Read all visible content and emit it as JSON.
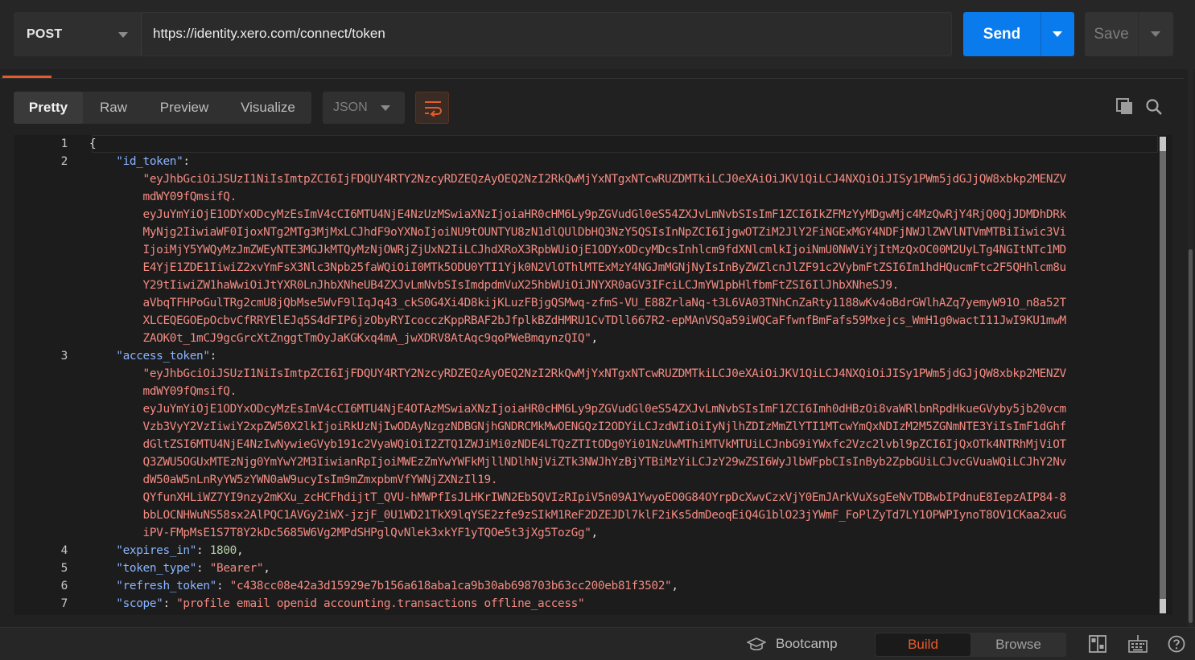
{
  "request": {
    "method": "POST",
    "url": "https://identity.xero.com/connect/token",
    "send_label": "Send",
    "save_label": "Save"
  },
  "response": {
    "view_modes": [
      "Pretty",
      "Raw",
      "Preview",
      "Visualize"
    ],
    "active_view": "Pretty",
    "format": "JSON",
    "lines": [
      {
        "n": "1",
        "parts": [
          {
            "t": "{",
            "c": "punc"
          }
        ]
      },
      {
        "n": "2",
        "parts": [
          {
            "t": "    ",
            "c": "punc"
          },
          {
            "t": "\"id_token\"",
            "c": "key"
          },
          {
            "t": ":",
            "c": "punc"
          }
        ]
      },
      {
        "n": "",
        "parts": [
          {
            "t": "        \"eyJhbGciOiJSUzI1NiIsImtpZCI6IjFDQUY4RTY2NzcyRDZEQzAyOEQ2NzI2RkQwMjYxNTgxNTcwRUZDMTkiLCJ0eXAiOiJKV1QiLCJ4NXQiOiJISy1PWm5jdGJjQW8xbkp2MENZV",
            "c": "str"
          }
        ]
      },
      {
        "n": "",
        "parts": [
          {
            "t": "        mdWY09fQmsifQ.",
            "c": "str"
          }
        ]
      },
      {
        "n": "",
        "parts": [
          {
            "t": "        eyJuYmYiOjE1ODYxODcyMzEsImV4cCI6MTU4NjE4NzUzMSwiaXNzIjoiaHR0cHM6Ly9pZGVudGl0eS54ZXJvLmNvbSIsImF1ZCI6IkZFMzYyMDgwMjc4MzQwRjY4RjQ0QjJDMDhDRk",
            "c": "str"
          }
        ]
      },
      {
        "n": "",
        "parts": [
          {
            "t": "        MyNjg2IiwiaWF0IjoxNTg2MTg3MjMxLCJhdF9oYXNoIjoiNU9tOUNTYU8zN1dlQUlDbHQ3NzY5QSIsInNpZCI6IjgwOTZiM2JlY2FiNGExMGY4NDFjNWJlZWVlNTVmMTBiIiwic3Vi",
            "c": "str"
          }
        ]
      },
      {
        "n": "",
        "parts": [
          {
            "t": "        IjoiMjY5YWQyMzJmZWEyNTE3MGJkMTQyMzNjOWRjZjUxN2IiLCJhdXRoX3RpbWUiOjE1ODYxODcyMDcsInhlcm9fdXNlcmlkIjoiNmU0NWViYjItMzQxOC00M2UyLTg4NGItNTc1MD",
            "c": "str"
          }
        ]
      },
      {
        "n": "",
        "parts": [
          {
            "t": "        E4YjE1ZDE1IiwiZ2xvYmFsX3Nlc3Npb25faWQiOiI0MTk5ODU0YTI1Yjk0N2VlOThlMTExMzY4NGJmMGNjNyIsInByZWZlcnJlZF91c2VybmFtZSI6Im1hdHQucmFtc2F5QHhlcm8u",
            "c": "str"
          }
        ]
      },
      {
        "n": "",
        "parts": [
          {
            "t": "        Y29tIiwiZW1haWwiOiJtYXR0LnJhbXNheUB4ZXJvLmNvbSIsImdpdmVuX25hbWUiOiJNYXR0aGV3IFciLCJmYW1pbHlfbmFtZSI6IlJhbXNheSJ9.",
            "c": "str"
          }
        ]
      },
      {
        "n": "",
        "parts": [
          {
            "t": "        aVbqTFHPoGulTRg2cmU8jQbMse5WvF9lIqJq43_ckS0G4Xi4D8kijKLuzFBjgQSMwq-zfmS-VU_E88ZrlaNq-t3L6VA03TNhCnZaRty1188wKv4oBdrGWlhAZq7yemyW91O_n8a52T",
            "c": "str"
          }
        ]
      },
      {
        "n": "",
        "parts": [
          {
            "t": "        XLCEQEGOEpOcbvCfRRYElEJq5S4dFIP6jzObyRYIcocczKppRBAF2bJfplkBZdHMRU1CvTDll667R2-epMAnVSQa59iWQCaFfwnfBmFafs59Mxejcs_WmH1g0wactI11JwI9KU1mwM",
            "c": "str"
          }
        ]
      },
      {
        "n": "",
        "parts": [
          {
            "t": "        ZAOK0t_1mCJ9gcGrcXtZnggtTmOyJaKGKxq4mA_jwXDRV8AtAqc9qoPWeBmqynzQIQ\"",
            "c": "str"
          },
          {
            "t": ",",
            "c": "punc"
          }
        ]
      },
      {
        "n": "3",
        "parts": [
          {
            "t": "    ",
            "c": "punc"
          },
          {
            "t": "\"access_token\"",
            "c": "key"
          },
          {
            "t": ":",
            "c": "punc"
          }
        ]
      },
      {
        "n": "",
        "parts": [
          {
            "t": "        \"eyJhbGciOiJSUzI1NiIsImtpZCI6IjFDQUY4RTY2NzcyRDZEQzAyOEQ2NzI2RkQwMjYxNTgxNTcwRUZDMTkiLCJ0eXAiOiJKV1QiLCJ4NXQiOiJISy1PWm5jdGJjQW8xbkp2MENZV",
            "c": "str"
          }
        ]
      },
      {
        "n": "",
        "parts": [
          {
            "t": "        mdWY09fQmsifQ.",
            "c": "str"
          }
        ]
      },
      {
        "n": "",
        "parts": [
          {
            "t": "        eyJuYmYiOjE1ODYxODcyMzEsImV4cCI6MTU4NjE4OTAzMSwiaXNzIjoiaHR0cHM6Ly9pZGVudGl0eS54ZXJvLmNvbSIsImF1ZCI6Imh0dHBzOi8vaWRlbnRpdHkueGVyby5jb20vcm",
            "c": "str"
          }
        ]
      },
      {
        "n": "",
        "parts": [
          {
            "t": "        Vzb3VyY2VzIiwiY2xpZW50X2lkIjoiRkUzNjIwODAyNzgzNDBGNjhGNDRCMkMwOENGQzI2ODYiLCJzdWIiOiIyNjlhZDIzMmZlYTI1MTcwYmQxNDIzM2M5ZGNmNTE3YiIsImF1dGhf",
            "c": "str"
          }
        ]
      },
      {
        "n": "",
        "parts": [
          {
            "t": "        dGltZSI6MTU4NjE4NzIwNywieGVyb191c2VyaWQiOiI2ZTQ1ZWJiMi0zNDE4LTQzZTItODg0Yi01NzUwMThiMTVkMTUiLCJnbG9iYWxfc2Vzc2lvbl9pZCI6IjQxOTk4NTRhMjViOT",
            "c": "str"
          }
        ]
      },
      {
        "n": "",
        "parts": [
          {
            "t": "        Q3ZWU5OGUxMTEzNjg0YmYwY2M3IiwianRpIjoiMWEzZmYwYWFkMjllNDlhNjViZTk3NWJhYzBjYTBiMzYiLCJzY29wZSI6WyJlbWFpbCIsInByb2ZpbGUiLCJvcGVuaWQiLCJhY2Nv",
            "c": "str"
          }
        ]
      },
      {
        "n": "",
        "parts": [
          {
            "t": "        dW50aW5nLnRyYW5zYWN0aW9ucyIsIm9mZmxpbmVfYWNjZXNzIl19.",
            "c": "str"
          }
        ]
      },
      {
        "n": "",
        "parts": [
          {
            "t": "        QYfunXHLiWZ7YI9nzy2mKXu_zcHCFhdijtT_QVU-hMWPfIsJLHKrIWN2Eb5QVIzRIpiV5n09A1YwyoEO0G84OYrpDcXwvCzxVjY0EmJArkVuXsgEeNvTDBwbIPdnuE8IepzAIP84-8",
            "c": "str"
          }
        ]
      },
      {
        "n": "",
        "parts": [
          {
            "t": "        bbLOCNHWuNS58sx2AlPQC1AVGy2iWX-jzjF_0U1WD21TkX9lqYSE2zfe9zSIkM1ReF2DZEJDl7klF2iKs5dmDeoqEiQ4G1blO23jYWmF_FoPlZyTd7LY1OPWPIynoT8OV1CKaa2xuG",
            "c": "str"
          }
        ]
      },
      {
        "n": "",
        "parts": [
          {
            "t": "        iPV-FMpMsE1S7T8Y2kDc5685W6Vg2MPdSHPglQvNlek3xkYF1yTQOe5t3jXg5TozGg\"",
            "c": "str"
          },
          {
            "t": ",",
            "c": "punc"
          }
        ]
      },
      {
        "n": "4",
        "parts": [
          {
            "t": "    ",
            "c": "punc"
          },
          {
            "t": "\"expires_in\"",
            "c": "key"
          },
          {
            "t": ": ",
            "c": "punc"
          },
          {
            "t": "1800",
            "c": "num"
          },
          {
            "t": ",",
            "c": "punc"
          }
        ]
      },
      {
        "n": "5",
        "parts": [
          {
            "t": "    ",
            "c": "punc"
          },
          {
            "t": "\"token_type\"",
            "c": "key"
          },
          {
            "t": ": ",
            "c": "punc"
          },
          {
            "t": "\"Bearer\"",
            "c": "str"
          },
          {
            "t": ",",
            "c": "punc"
          }
        ]
      },
      {
        "n": "6",
        "parts": [
          {
            "t": "    ",
            "c": "punc"
          },
          {
            "t": "\"refresh_token\"",
            "c": "key"
          },
          {
            "t": ": ",
            "c": "punc"
          },
          {
            "t": "\"c438cc08e42a3d15929e7b156a618aba1ca9b30ab698703b63cc200eb81f3502\"",
            "c": "str"
          },
          {
            "t": ",",
            "c": "punc"
          }
        ]
      },
      {
        "n": "7",
        "parts": [
          {
            "t": "    ",
            "c": "punc"
          },
          {
            "t": "\"scope\"",
            "c": "key"
          },
          {
            "t": ": ",
            "c": "punc"
          },
          {
            "t": "\"profile email openid accounting.transactions offline_access\"",
            "c": "str"
          }
        ]
      }
    ]
  },
  "footer": {
    "bootcamp_label": "Bootcamp",
    "build_label": "Build",
    "browse_label": "Browse",
    "active_mode": "Build"
  },
  "colors": {
    "accent": "#097bed",
    "active_tab": "#e35d2c",
    "json_key": "#8ab4ff",
    "json_string": "#f28b82",
    "json_number": "#b5cea8"
  },
  "icons": {
    "method_dropdown": "chevron-down-icon",
    "send_dropdown": "chevron-down-icon",
    "save_dropdown": "chevron-down-icon",
    "wrap_lines": "wrap-lines-icon",
    "copy": "copy-icon",
    "search": "search-icon",
    "bootcamp": "graduation-cap-icon",
    "two_pane": "two-pane-icon",
    "keyboard": "keyboard-icon",
    "help": "help-icon"
  }
}
